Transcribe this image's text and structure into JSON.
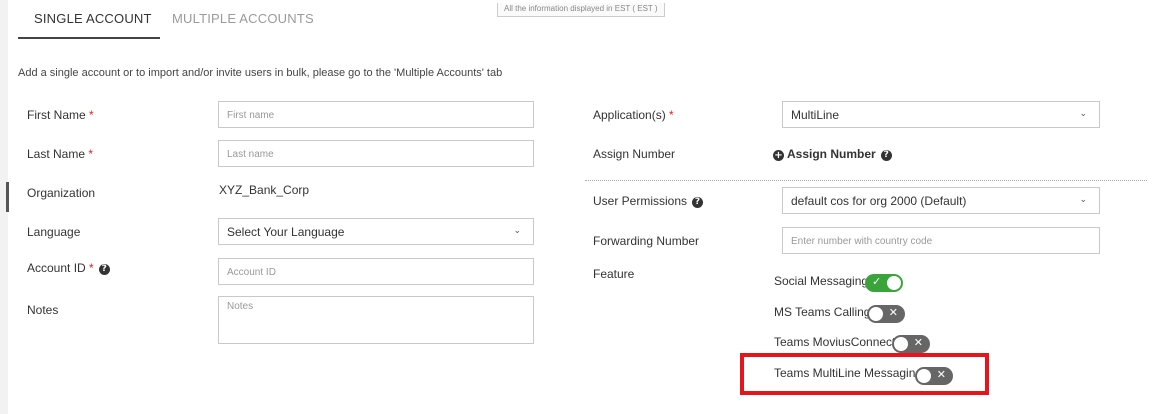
{
  "tabs": [
    {
      "label": "SINGLE ACCOUNT",
      "active": true
    },
    {
      "label": "MULTIPLE ACCOUNTS",
      "active": false
    }
  ],
  "timezone_note": "All the information displayed in EST ( EST )",
  "intro_text": "Add a single account or to import and/or invite users in bulk, please go to the 'Multiple Accounts' tab",
  "form_left": {
    "first_name": {
      "label": "First Name",
      "required_mark": "*",
      "value": "",
      "placeholder": "First name"
    },
    "last_name": {
      "label": "Last Name",
      "required_mark": "*",
      "value": "",
      "placeholder": "Last name"
    },
    "organization": {
      "label": "Organization",
      "value": "XYZ_Bank_Corp"
    },
    "language": {
      "label": "Language",
      "selected": "Select Your Language"
    },
    "account_id": {
      "label": "Account ID",
      "required_mark": "*",
      "value": "",
      "placeholder": "Account ID"
    },
    "notes": {
      "label": "Notes",
      "value": "",
      "placeholder": "Notes"
    }
  },
  "form_right": {
    "applications": {
      "label": "Application(s)",
      "required_mark": "*",
      "selected": "MultiLine"
    },
    "assign_number": {
      "label": "Assign Number",
      "link_text": "Assign Number"
    },
    "user_permissions": {
      "label": "User Permissions",
      "selected": "default cos for org 2000 (Default)"
    },
    "forwarding_number": {
      "label": "Forwarding Number",
      "value": "",
      "placeholder": "Enter number with country code"
    },
    "feature": {
      "label": "Feature"
    }
  },
  "features": [
    {
      "label": "Social Messaging",
      "enabled": true
    },
    {
      "label": "MS Teams Calling",
      "enabled": false
    },
    {
      "label": "Teams MoviusConnect",
      "enabled": false
    },
    {
      "label": "Teams MultiLine Messaging",
      "enabled": false
    }
  ],
  "icons": {
    "help": "question-circle-icon",
    "plus": "plus-circle-icon",
    "chevron": "chevron-down-icon",
    "toggle_on_glyph": "✓",
    "toggle_off_glyph": "✕"
  },
  "colors": {
    "required": "#e02020",
    "toggle_on": "#3aa33a",
    "toggle_off": "#666666",
    "highlight": "#e8141b"
  }
}
